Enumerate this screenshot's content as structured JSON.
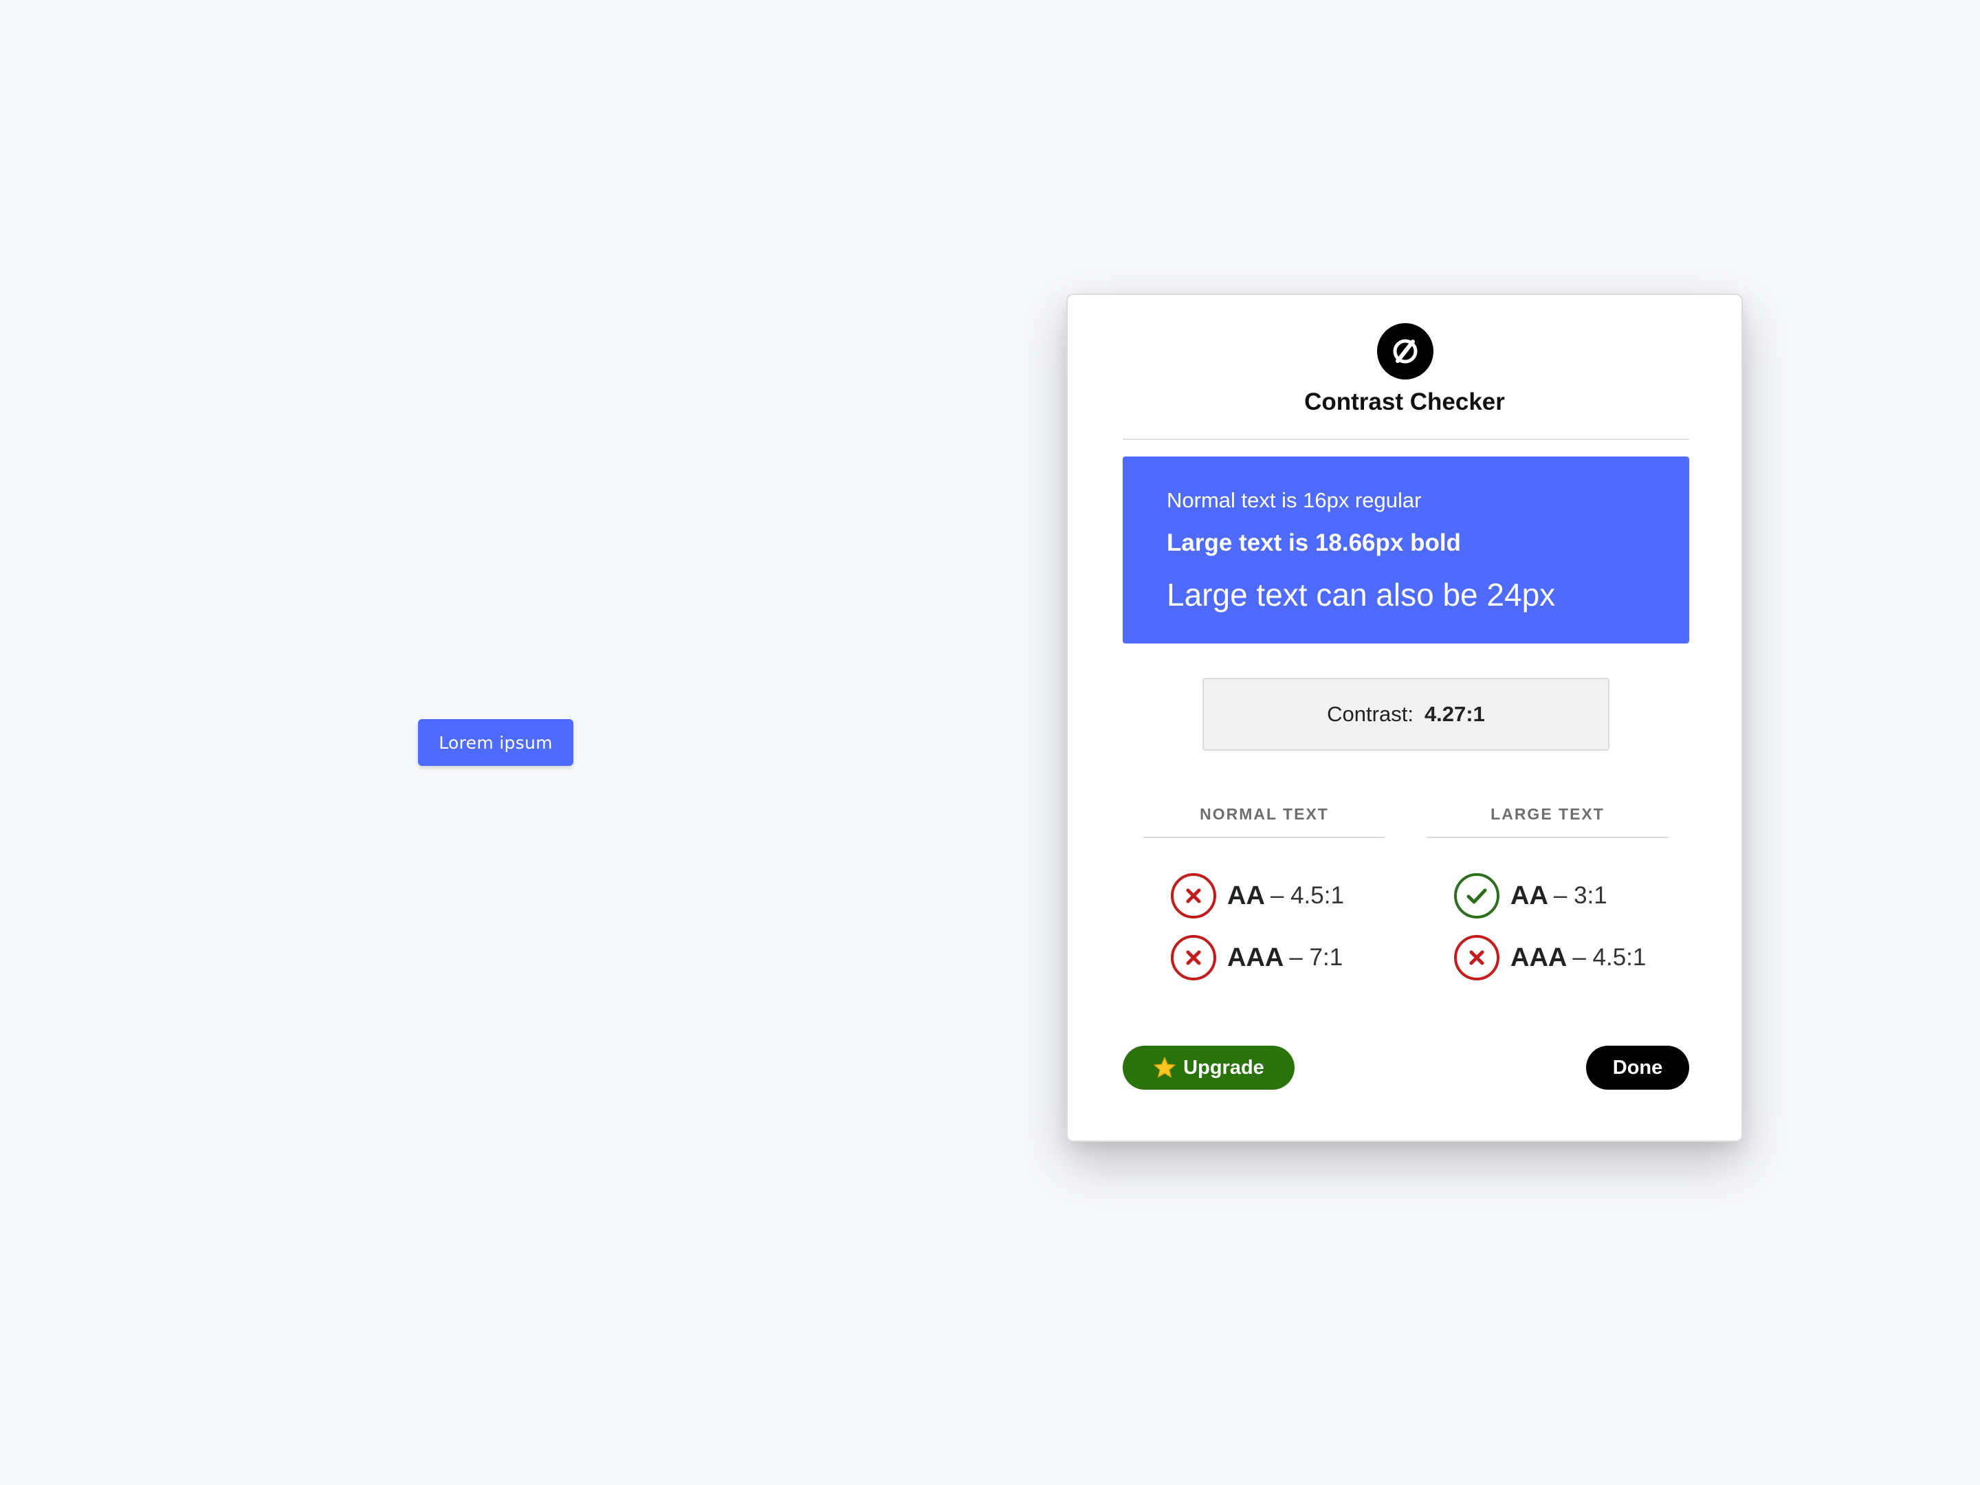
{
  "page": {
    "background": "#f7f8fc"
  },
  "sample_button": {
    "label": "Lorem ipsum",
    "color": "#4f6bfd"
  },
  "dialog": {
    "title": "Contrast Checker",
    "logo_icon": "contrast-logo-icon",
    "preview": {
      "background": "#4f6bfd",
      "normal_text": "Normal text is 16px regular",
      "bold_text": "Large text is 18.66px bold",
      "large_text": "Large text can also be 24px"
    },
    "contrast": {
      "label": "Contrast:",
      "value": "4.27:1"
    },
    "columns": [
      {
        "header": "NORMAL TEXT",
        "results": [
          {
            "level": "AA",
            "ratio": "– 4.5:1",
            "status": "fail",
            "icon": "x-circle-icon"
          },
          {
            "level": "AAA",
            "ratio": "– 7:1",
            "status": "fail",
            "icon": "x-circle-icon"
          }
        ]
      },
      {
        "header": "LARGE TEXT",
        "results": [
          {
            "level": "AA",
            "ratio": "– 3:1",
            "status": "pass",
            "icon": "check-circle-icon"
          },
          {
            "level": "AAA",
            "ratio": "– 4.5:1",
            "status": "fail",
            "icon": "x-circle-icon"
          }
        ]
      }
    ],
    "colors": {
      "fail": "#c21c1c",
      "pass": "#2c6e1e"
    },
    "upgrade_button": {
      "label": "Upgrade",
      "icon": "star-icon",
      "color": "#2a730b"
    },
    "done_button": {
      "label": "Done",
      "color": "#000000"
    }
  }
}
